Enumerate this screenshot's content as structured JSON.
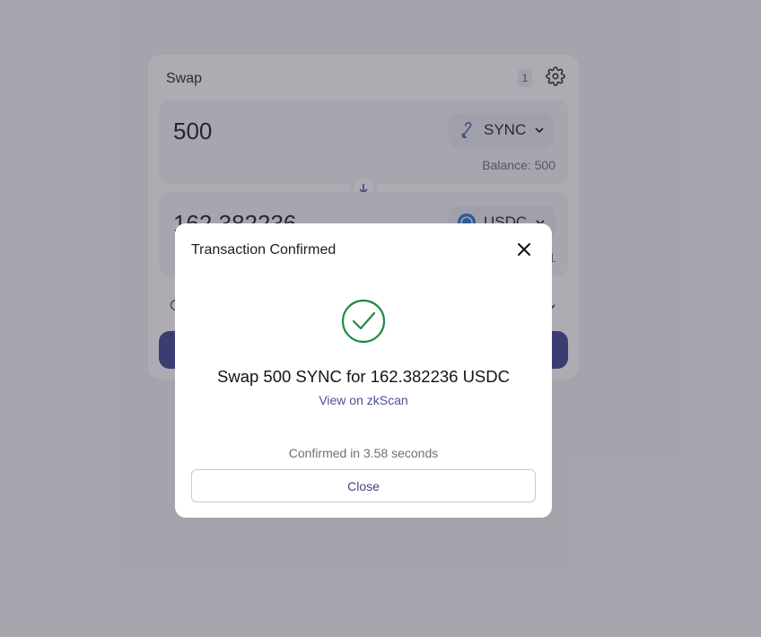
{
  "swap": {
    "title": "Swap",
    "slippage_badge": "1",
    "from": {
      "amount": "500",
      "token": "SYNC",
      "balance": "Balance: 500"
    },
    "to": {
      "amount": "162.382236",
      "token": "USDC",
      "balance": "1"
    }
  },
  "modal": {
    "title": "Transaction Confirmed",
    "summary": "Swap 500 SYNC for 162.382236 USDC",
    "link_label": "View on zkScan",
    "confirmed_text": "Confirmed in 3.58 seconds",
    "close_label": "Close"
  },
  "colors": {
    "accent": "#3b3f8f",
    "success": "#1f8a44",
    "link": "#4a4f9a"
  },
  "icons": {
    "settings": "gear-icon",
    "close": "close-icon",
    "success": "check-circle-icon",
    "swap_direction": "arrow-down-icon",
    "sync_token": "sync-token-icon",
    "usdc_token": "usdc-token-icon"
  }
}
